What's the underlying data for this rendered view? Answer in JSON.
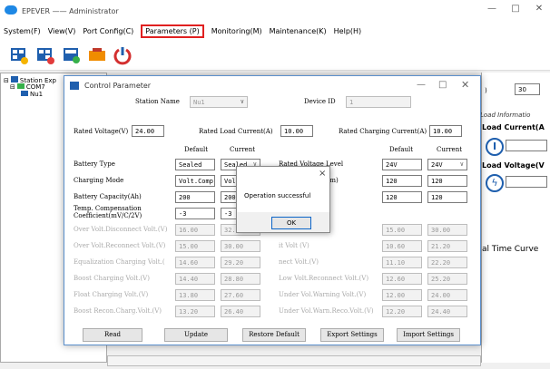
{
  "app": {
    "title": "EPEVER —— Administrator"
  },
  "menu": [
    {
      "label": "System(F)",
      "active": false
    },
    {
      "label": "View(V)",
      "active": false
    },
    {
      "label": "Port Config(C)",
      "active": false
    },
    {
      "label": "Parameters (P)",
      "active": true
    },
    {
      "label": "Monitoring(M)",
      "active": false
    },
    {
      "label": "Maintenance(K)",
      "active": false
    },
    {
      "label": "Help(H)",
      "active": false
    }
  ],
  "tree": {
    "root": "Station Exp",
    "port": "COM7",
    "device": "Nu1"
  },
  "right_pane": {
    "value_30": "30",
    "load_info": "Load Informatio",
    "load_current": "Load Current(A",
    "load_voltage": "Load Voltage(V",
    "real_time": "al Time Curve"
  },
  "dialog": {
    "title": "Control Parameter",
    "station_name_label": "Station Name",
    "station_name_value": "Nu1",
    "device_id_label": "Device ID",
    "device_id_value": "1",
    "rated_voltage_label": "Rated Voltage(V)",
    "rated_voltage_value": "24.00",
    "rated_load_current_label": "Rated Load Current(A)",
    "rated_load_current_value": "10.00",
    "rated_charging_current_label": "Rated Charging Current(A)",
    "rated_charging_current_value": "10.00",
    "col_default": "Default",
    "col_current": "Current",
    "left_rows": [
      {
        "label": "Battery Type",
        "default": "Sealed",
        "current": "Sealed",
        "combo": true,
        "dis": false
      },
      {
        "label": "Charging Mode",
        "default": "Volt.Comp.",
        "current": "Volt.Com",
        "combo": true,
        "dis": false
      },
      {
        "label": "Battery Capacity(Ah)",
        "default": "200",
        "current": "200",
        "combo": false,
        "dis": false
      },
      {
        "label": "Temp. Compensation",
        "label2": "Coefficient(mV/C/2V)",
        "default": "-3",
        "current": "-3",
        "combo": false,
        "dis": false
      },
      {
        "label": "Over Volt.Disconnect Volt.(V)",
        "default": "16.00",
        "current": "32.00",
        "combo": false,
        "dis": true
      },
      {
        "label": "Over Volt.Reconnect Volt.(V)",
        "default": "15.00",
        "current": "30.00",
        "combo": false,
        "dis": true
      },
      {
        "label": "Equalization Charging Volt.(",
        "default": "14.60",
        "current": "29.20",
        "combo": false,
        "dis": true
      },
      {
        "label": "Boost Charging Volt.(V)",
        "default": "14.40",
        "current": "28.80",
        "combo": false,
        "dis": true
      },
      {
        "label": "Float Charging Volt.(V)",
        "default": "13.80",
        "current": "27.60",
        "combo": false,
        "dis": true
      },
      {
        "label": "Boost Recon.Charg.Volt.(V)",
        "default": "13.20",
        "current": "26.40",
        "combo": false,
        "dis": true
      }
    ],
    "right_rows": [
      {
        "label": "Rated Voltage Level",
        "default": "24V",
        "current": "24V",
        "combo": true,
        "dis": false
      },
      {
        "label": "Boost Duration(m)",
        "default": "120",
        "current": "120",
        "combo": false,
        "dis": false
      },
      {
        "label": "uration (m)",
        "default": "120",
        "current": "120",
        "combo": false,
        "dis": false
      },
      {
        "label": "",
        "default": "",
        "current": "",
        "combo": false,
        "dis": false,
        "hidden": true
      },
      {
        "label": "Voltage(V)",
        "default": "15.00",
        "current": "30.00",
        "combo": false,
        "dis": true
      },
      {
        "label": "it Volt (V)",
        "default": "10.60",
        "current": "21.20",
        "combo": false,
        "dis": true
      },
      {
        "label": "nect Volt.(V)",
        "default": "11.10",
        "current": "22.20",
        "combo": false,
        "dis": true
      },
      {
        "label": "Low Volt.Reconnect Volt.(V)",
        "default": "12.60",
        "current": "25.20",
        "combo": false,
        "dis": true
      },
      {
        "label": "Under Vol.Warning Volt.(V)",
        "default": "12.00",
        "current": "24.00",
        "combo": false,
        "dis": true
      },
      {
        "label": "Under Vol.Warn.Reco.Volt.(V)",
        "default": "12.20",
        "current": "24.40",
        "combo": false,
        "dis": true
      }
    ],
    "buttons": {
      "read": "Read",
      "update": "Update",
      "restore": "Restore Default",
      "export": "Export Settings",
      "import": "Import Settings"
    }
  },
  "popup": {
    "message": "Operation successful",
    "ok": "OK",
    "close": "×"
  },
  "colors": {
    "highlight": "#e02020",
    "dialog_border": "#5b8fcc",
    "ok_border": "#0a64c8"
  },
  "icons": [
    "add-device-icon",
    "add-device-alt-icon",
    "config-icon",
    "battery-icon",
    "power-icon",
    "lightbulb-icon",
    "bolt-icon"
  ]
}
